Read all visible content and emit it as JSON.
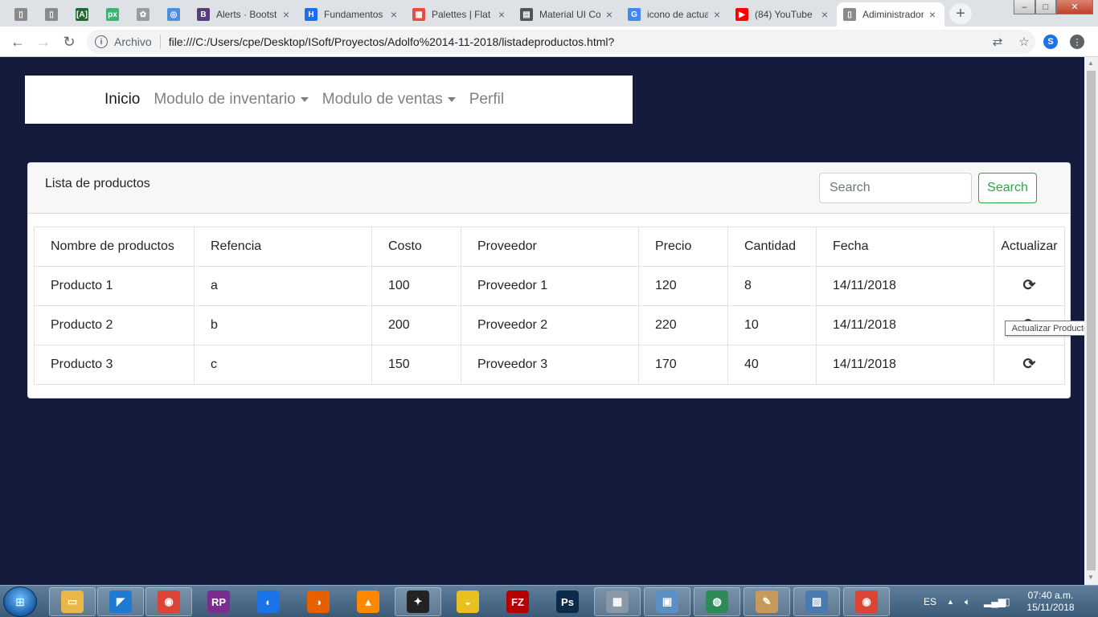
{
  "browser": {
    "tabs": [
      {
        "title": "",
        "icon": "document-icon",
        "color": "#8a8a8a",
        "glyph": "▯"
      },
      {
        "title": "",
        "icon": "document-icon",
        "color": "#8a8a8a",
        "glyph": "▯"
      },
      {
        "title": "",
        "icon": "brackets-app-icon",
        "color": "#1e6b2f",
        "glyph": "[A]"
      },
      {
        "title": "",
        "icon": "px-app-icon",
        "color": "#3cb371",
        "glyph": "px"
      },
      {
        "title": "",
        "icon": "ornament-icon",
        "color": "#9b9b9b",
        "glyph": "✿"
      },
      {
        "title": "",
        "icon": "color-ring-icon",
        "color": "#4a8fe2",
        "glyph": "◎"
      },
      {
        "title": "Alerts · Bootstrap",
        "icon": "bootstrap-icon",
        "color": "#563d7c",
        "glyph": "B"
      },
      {
        "title": "Fundamentos",
        "icon": "h-logo-icon",
        "color": "#1b6ef3",
        "glyph": "H"
      },
      {
        "title": "Palettes | Flat UI",
        "icon": "palette-grid-icon",
        "color": "#e84c3d",
        "glyph": "▦"
      },
      {
        "title": "Material UI Colors",
        "icon": "material-icon",
        "color": "#555555",
        "glyph": "▤"
      },
      {
        "title": "icono de actualizar",
        "icon": "google-icon",
        "color": "#4285f4",
        "glyph": "G"
      },
      {
        "title": "(84) YouTube",
        "icon": "youtube-icon",
        "color": "#ff0000",
        "glyph": "▶"
      },
      {
        "title": "Adiministrador",
        "icon": "document-icon",
        "color": "#8a8a8a",
        "glyph": "▯",
        "active": true
      }
    ],
    "close_glyph": "×",
    "newtab_glyph": "+",
    "address": {
      "security_label": "Archivo",
      "url": "file:///C:/Users/cpe/Desktop/ISoft/Proyectos/Adolfo%2014-11-2018/listadeproductos.html?"
    },
    "window_controls": {
      "minimize": "–",
      "maximize": "□",
      "close": "✕"
    }
  },
  "navbar": {
    "items": [
      {
        "label": "Inicio",
        "dropdown": false,
        "active": true
      },
      {
        "label": "Modulo de inventario",
        "dropdown": true,
        "active": false
      },
      {
        "label": "Modulo de ventas",
        "dropdown": true,
        "active": false
      },
      {
        "label": "Perfil",
        "dropdown": false,
        "active": false
      }
    ]
  },
  "card": {
    "title": "Lista de productos",
    "search_placeholder": "Search",
    "search_button": "Search"
  },
  "table": {
    "headers": [
      "Nombre de productos",
      "Refencia",
      "Costo",
      "Proveedor",
      "Precio",
      "Cantidad",
      "Fecha",
      "Actualizar"
    ],
    "rows": [
      [
        "Producto 1",
        "a",
        "100",
        "Proveedor 1",
        "120",
        "8",
        "14/11/2018"
      ],
      [
        "Producto 2",
        "b",
        "200",
        "Proveedor 2",
        "220",
        "10",
        "14/11/2018"
      ],
      [
        "Producto 3",
        "c",
        "150",
        "Proveedor 3",
        "170",
        "40",
        "14/11/2018"
      ]
    ],
    "refresh_glyph": "⟳"
  },
  "tooltip": "Actualizar Producto",
  "taskbar": {
    "apps": [
      {
        "name": "explorer-icon",
        "color": "#e8b84a",
        "glyph": "▭"
      },
      {
        "name": "vscode-icon",
        "color": "#1f7ad1",
        "glyph": "◤"
      },
      {
        "name": "chrome-icon",
        "color": "#db4437",
        "glyph": "◉"
      },
      {
        "name": "rp-app-icon",
        "color": "#7b2d8e",
        "glyph": "RP"
      },
      {
        "name": "firefox-dev-icon",
        "color": "#1a73e8",
        "glyph": "◐"
      },
      {
        "name": "firefox-icon",
        "color": "#e66000",
        "glyph": "◑"
      },
      {
        "name": "vlc-icon",
        "color": "#ff8800",
        "glyph": "▲"
      },
      {
        "name": "bee-app-icon",
        "color": "#222222",
        "glyph": "✦"
      },
      {
        "name": "slides-app-icon",
        "color": "#e8c020",
        "glyph": "◒"
      },
      {
        "name": "filezilla-icon",
        "color": "#b40000",
        "glyph": "FZ"
      },
      {
        "name": "photoshop-icon",
        "color": "#0b2a4a",
        "glyph": "Ps"
      },
      {
        "name": "calculator-icon",
        "color": "#8a98a8",
        "glyph": "▦"
      },
      {
        "name": "control-panel-icon",
        "color": "#5d8fc7",
        "glyph": "▣"
      },
      {
        "name": "globe-app-icon",
        "color": "#2e8b57",
        "glyph": "◍"
      },
      {
        "name": "paint-icon",
        "color": "#c89a5a",
        "glyph": "✎"
      },
      {
        "name": "image-viewer-icon",
        "color": "#4a7ab0",
        "glyph": "▨"
      },
      {
        "name": "chrome-icon",
        "color": "#db4437",
        "glyph": "◉"
      }
    ],
    "language": "ES",
    "time": "07:40 a.m.",
    "date": "15/11/2018"
  }
}
